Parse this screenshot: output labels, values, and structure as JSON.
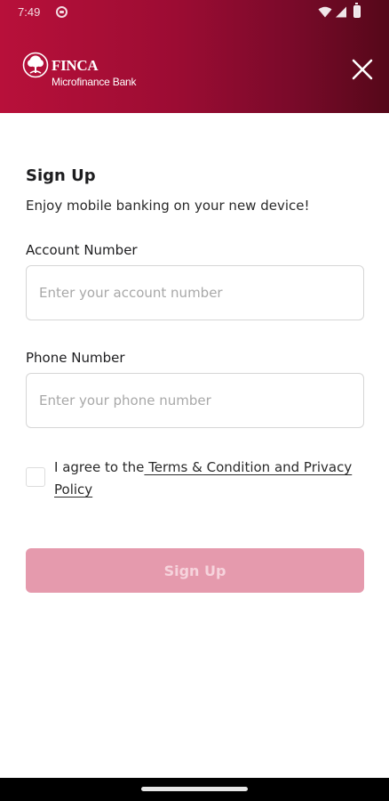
{
  "status_bar": {
    "time": "7:49",
    "icons": [
      "notification-icon",
      "wifi-icon",
      "cell-signal-icon",
      "battery-icon"
    ]
  },
  "header": {
    "brand_name": "FINCA",
    "brand_sub": "Microfinance Bank",
    "close_icon": "close-icon",
    "gradient_colors": [
      "#b8103a",
      "#550819"
    ]
  },
  "form": {
    "title": "Sign Up",
    "subtitle": "Enjoy mobile banking on your new device!",
    "account": {
      "label": "Account Number",
      "placeholder": "Enter your account number",
      "value": ""
    },
    "phone": {
      "label": "Phone Number",
      "placeholder": "Enter your phone number",
      "value": ""
    },
    "agree": {
      "checked": false,
      "prefix": "I agree to the",
      "link_text": " Terms & Condition and Privacy Policy"
    },
    "submit_label": "Sign Up",
    "submit_enabled": false
  },
  "colors": {
    "accent": "#a50d36",
    "button_disabled": "#e59aad"
  }
}
